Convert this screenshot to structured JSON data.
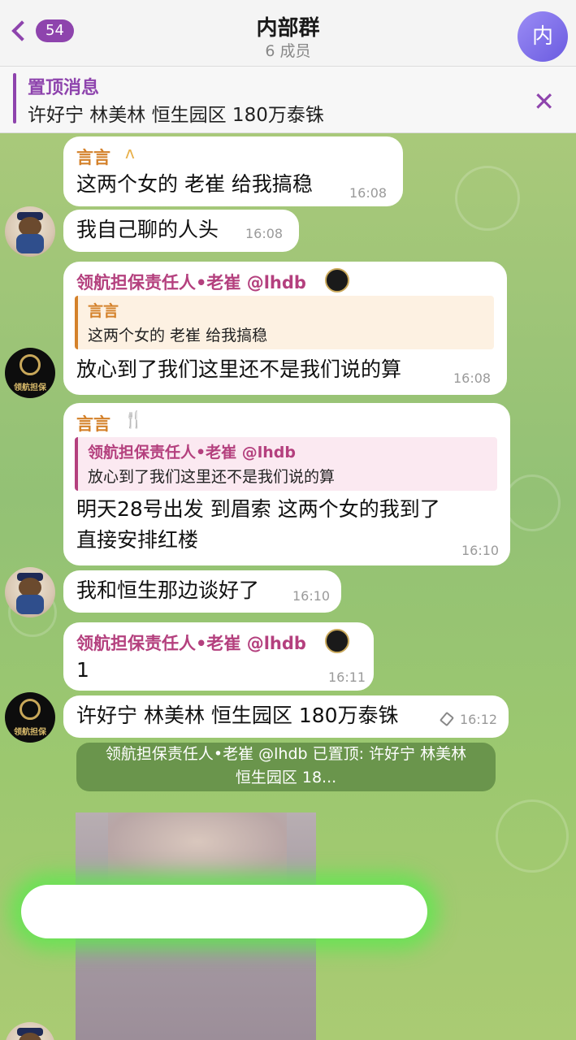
{
  "header": {
    "back_count": "54",
    "title": "内部群",
    "subtitle": "6 成员",
    "avatar_text": "内"
  },
  "pinned": {
    "label": "置顶消息",
    "text": "许好宁 林美林 恒生园区 180万泰铢"
  },
  "messages": [
    {
      "sender": "言言",
      "sender_icon": "wave-emoji",
      "text": "这两个女的 老崔 给我搞稳",
      "time": "16:08"
    },
    {
      "text": "我自己聊的人头",
      "time": "16:08"
    },
    {
      "sender": "领航担保责任人•老崔 @lhdb",
      "reply_name": "言言",
      "reply_text": "这两个女的 老崔 给我搞稳",
      "text": "放心到了我们这里还不是我们说的算",
      "time": "16:08"
    },
    {
      "sender": "言言",
      "sender_icon": "cutlery-emoji",
      "reply_name": "领航担保责任人•老崔 @lhdb",
      "reply_text": "放心到了我们这里还不是我们说的算",
      "text_line1": "明天28号出发 到眉索 这两个女的我到了",
      "text_line2": "直接安排红楼",
      "time": "16:10"
    },
    {
      "text": "我和恒生那边谈好了",
      "time": "16:10"
    },
    {
      "sender": "领航担保责任人•老崔 @lhdb",
      "text": "1",
      "time": "16:11"
    },
    {
      "text": "许好宁 林美林 恒生园区 180万泰铢",
      "time": "16:12"
    }
  ],
  "service_message": {
    "line1": "领航担保责任人•老崔 @lhdb 已置顶: 许好宁 林美林",
    "line2": "恒生园区 18..."
  },
  "avatar_label": "领航担保",
  "colors": {
    "accent": "#8e44ad",
    "sender_orange": "#d4812a",
    "sender_pink": "#b4407e",
    "reply_orange_bg": "#fdf1e2",
    "reply_pink_bg": "#fbe9f1"
  }
}
